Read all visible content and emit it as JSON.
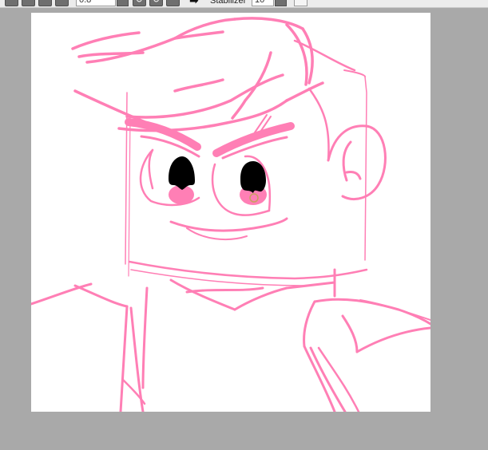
{
  "toolbar": {
    "brush_size_value": "0.8",
    "stabilizer_label": "Stabilizer",
    "stabilizer_value": "10",
    "arrow_glyph": "➡",
    "rotate_left_glyph": "↺",
    "rotate_right_glyph": "↻"
  },
  "canvas": {
    "background": "#ffffff",
    "stroke_color": "#ff7fb5",
    "fill_color": "#ff7fb5",
    "pupil_color": "#000000"
  },
  "workspace": {
    "background": "#a9a9a9"
  }
}
